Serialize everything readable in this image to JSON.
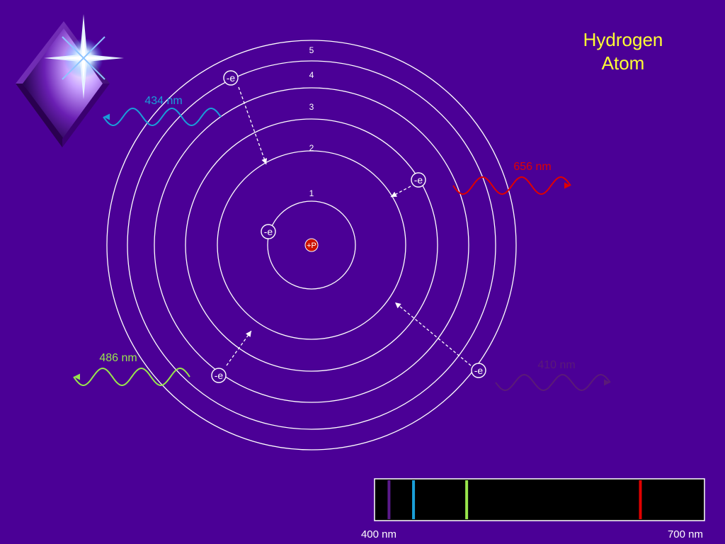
{
  "title": {
    "line1": "Hydrogen",
    "line2": "Atom"
  },
  "nucleus_label": "+P",
  "electron_label": "-e",
  "shell_labels": [
    "1",
    "2",
    "3",
    "4",
    "5"
  ],
  "emissions": [
    {
      "label": "656 nm",
      "color": "#e00000"
    },
    {
      "label": "486 nm",
      "color": "#99e64c"
    },
    {
      "label": "434 nm",
      "color": "#1a9fd9"
    },
    {
      "label": "410 nm",
      "color": "#5a1a78"
    }
  ],
  "spectrum": {
    "min_label": "400 nm",
    "max_label": "700 nm",
    "lines": [
      {
        "nm": 410,
        "color": "#5a1a8a"
      },
      {
        "nm": 434,
        "color": "#1a9fd9"
      },
      {
        "nm": 486,
        "color": "#99e64c"
      },
      {
        "nm": 656,
        "color": "#e00000"
      }
    ]
  },
  "colors": {
    "background": "#4b0096",
    "title": "#ffff33",
    "orbit": "#ffffff",
    "nucleus": "#cc1100"
  }
}
